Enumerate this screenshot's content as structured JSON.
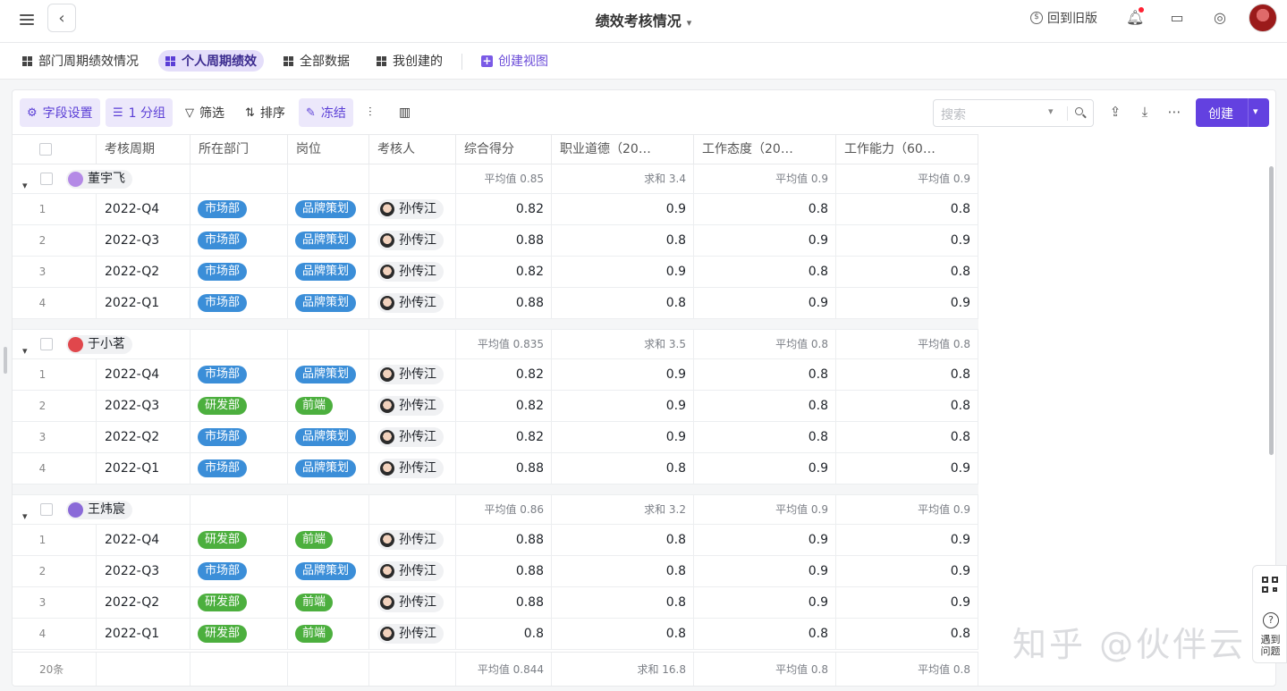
{
  "header": {
    "title": "绩效考核情况",
    "old_version": "回到旧版"
  },
  "views": {
    "tabs": [
      "部门周期绩效情况",
      "个人周期绩效",
      "全部数据",
      "我创建的"
    ],
    "create": "创建视图"
  },
  "toolbar": {
    "field_settings": "字段设置",
    "group": "1 分组",
    "filter": "筛选",
    "sort": "排序",
    "freeze": "冻结",
    "search_placeholder": "搜索",
    "create": "创建"
  },
  "columns": [
    "考核周期",
    "所在部门",
    "岗位",
    "考核人",
    "综合得分",
    "职业道德（20…",
    "工作态度（20…",
    "工作能力（60…"
  ],
  "colors": {
    "accent": "#6341e0",
    "tag_blue": "#3b8ed8",
    "tag_green": "#4caf3e"
  },
  "groups": [
    {
      "name": "董宇飞",
      "aggs": [
        "平均值 0.85",
        "求和 3.4",
        "平均值 0.9",
        "平均值 0.9"
      ],
      "rows": [
        {
          "idx": "1",
          "period": "2022-Q4",
          "dept": "市场部",
          "dept_color": "blue",
          "role": "品牌策划",
          "role_color": "blue",
          "reviewer": "孙传江",
          "score": "0.82",
          "ethics": "0.9",
          "attitude": "0.8",
          "ability": "0.8"
        },
        {
          "idx": "2",
          "period": "2022-Q3",
          "dept": "市场部",
          "dept_color": "blue",
          "role": "品牌策划",
          "role_color": "blue",
          "reviewer": "孙传江",
          "score": "0.88",
          "ethics": "0.8",
          "attitude": "0.9",
          "ability": "0.9"
        },
        {
          "idx": "3",
          "period": "2022-Q2",
          "dept": "市场部",
          "dept_color": "blue",
          "role": "品牌策划",
          "role_color": "blue",
          "reviewer": "孙传江",
          "score": "0.82",
          "ethics": "0.9",
          "attitude": "0.8",
          "ability": "0.8"
        },
        {
          "idx": "4",
          "period": "2022-Q1",
          "dept": "市场部",
          "dept_color": "blue",
          "role": "品牌策划",
          "role_color": "blue",
          "reviewer": "孙传江",
          "score": "0.88",
          "ethics": "0.8",
          "attitude": "0.9",
          "ability": "0.9"
        }
      ]
    },
    {
      "name": "于小茗",
      "aggs": [
        "平均值 0.835",
        "求和 3.5",
        "平均值 0.8",
        "平均值 0.8"
      ],
      "rows": [
        {
          "idx": "1",
          "period": "2022-Q4",
          "dept": "市场部",
          "dept_color": "blue",
          "role": "品牌策划",
          "role_color": "blue",
          "reviewer": "孙传江",
          "score": "0.82",
          "ethics": "0.9",
          "attitude": "0.8",
          "ability": "0.8"
        },
        {
          "idx": "2",
          "period": "2022-Q3",
          "dept": "研发部",
          "dept_color": "green",
          "role": "前端",
          "role_color": "green",
          "reviewer": "孙传江",
          "score": "0.82",
          "ethics": "0.9",
          "attitude": "0.8",
          "ability": "0.8"
        },
        {
          "idx": "3",
          "period": "2022-Q2",
          "dept": "市场部",
          "dept_color": "blue",
          "role": "品牌策划",
          "role_color": "blue",
          "reviewer": "孙传江",
          "score": "0.82",
          "ethics": "0.9",
          "attitude": "0.8",
          "ability": "0.8"
        },
        {
          "idx": "4",
          "period": "2022-Q1",
          "dept": "市场部",
          "dept_color": "blue",
          "role": "品牌策划",
          "role_color": "blue",
          "reviewer": "孙传江",
          "score": "0.88",
          "ethics": "0.8",
          "attitude": "0.9",
          "ability": "0.9"
        }
      ]
    },
    {
      "name": "王炜宸",
      "aggs": [
        "平均值 0.86",
        "求和 3.2",
        "平均值 0.9",
        "平均值 0.9"
      ],
      "rows": [
        {
          "idx": "1",
          "period": "2022-Q4",
          "dept": "研发部",
          "dept_color": "green",
          "role": "前端",
          "role_color": "green",
          "reviewer": "孙传江",
          "score": "0.88",
          "ethics": "0.8",
          "attitude": "0.9",
          "ability": "0.9"
        },
        {
          "idx": "2",
          "period": "2022-Q3",
          "dept": "市场部",
          "dept_color": "blue",
          "role": "品牌策划",
          "role_color": "blue",
          "reviewer": "孙传江",
          "score": "0.88",
          "ethics": "0.8",
          "attitude": "0.9",
          "ability": "0.9"
        },
        {
          "idx": "3",
          "period": "2022-Q2",
          "dept": "研发部",
          "dept_color": "green",
          "role": "前端",
          "role_color": "green",
          "reviewer": "孙传江",
          "score": "0.88",
          "ethics": "0.8",
          "attitude": "0.9",
          "ability": "0.9"
        },
        {
          "idx": "4",
          "period": "2022-Q1",
          "dept": "研发部",
          "dept_color": "green",
          "role": "前端",
          "role_color": "green",
          "reviewer": "孙传江",
          "score": "0.8",
          "ethics": "0.8",
          "attitude": "0.8",
          "ability": "0.8"
        }
      ]
    }
  ],
  "footer": {
    "count": "20条",
    "aggs": [
      "平均值 0.844",
      "求和 16.8",
      "平均值 0.8",
      "平均值 0.8"
    ]
  },
  "side_widget": {
    "help": "遇到问题"
  },
  "watermark": "知乎 @伙伴云"
}
